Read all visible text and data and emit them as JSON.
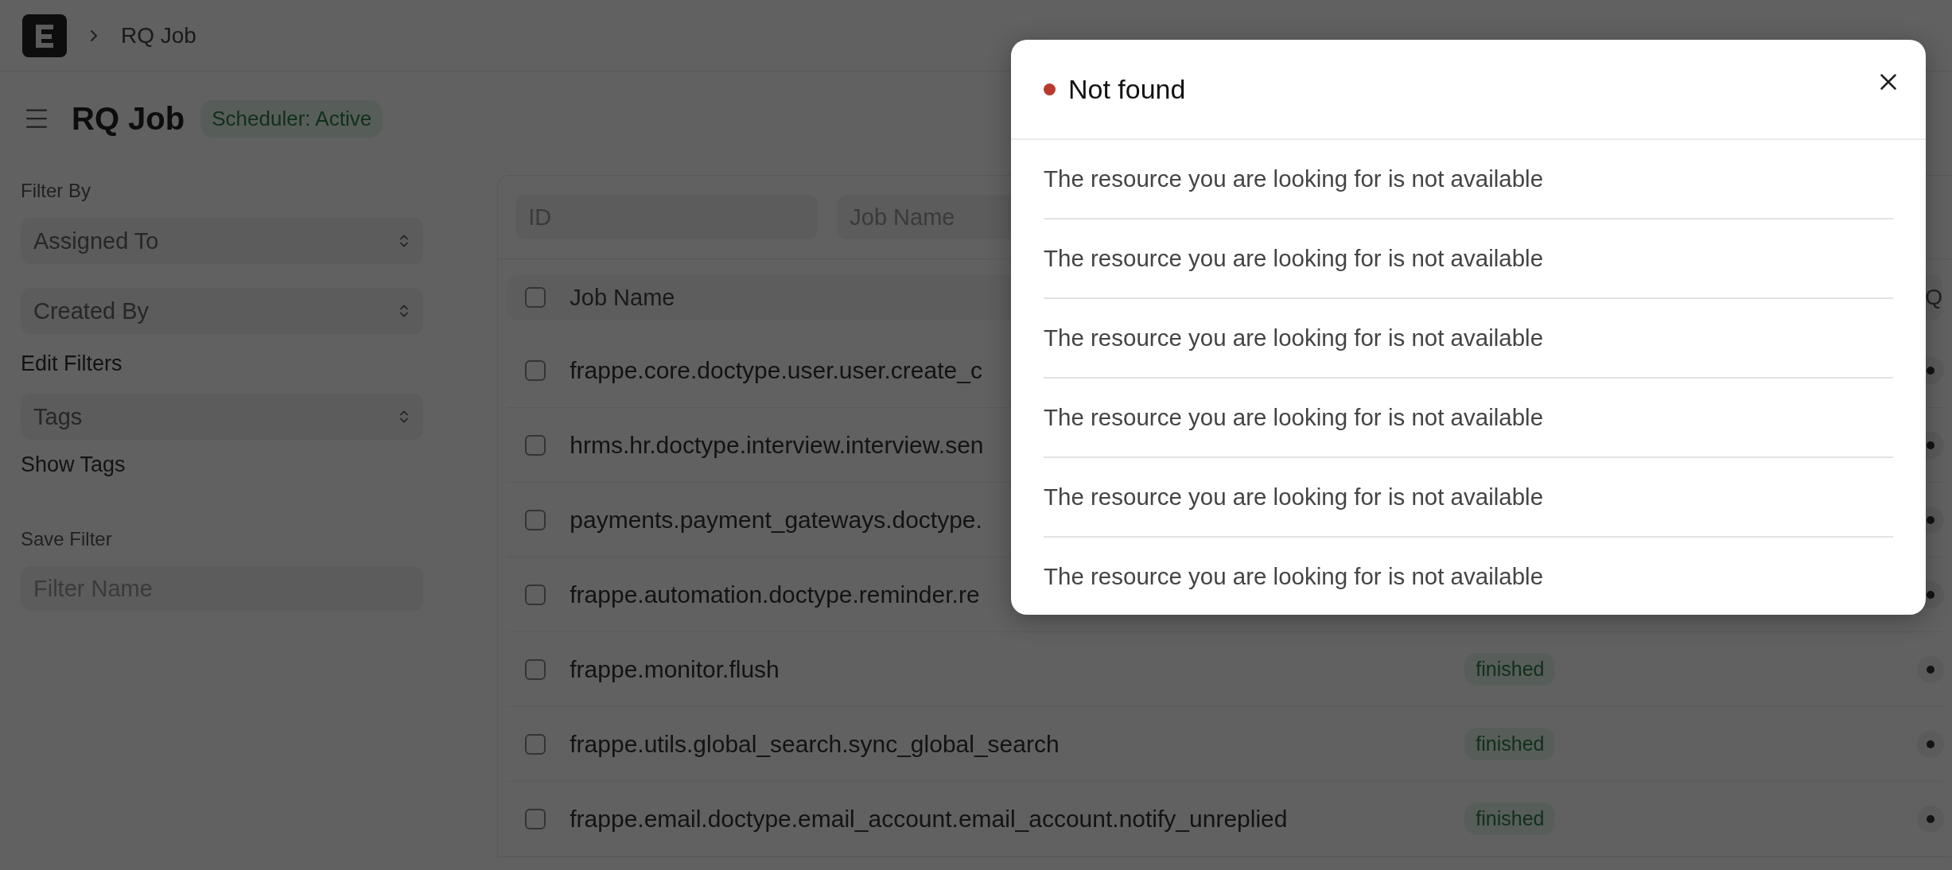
{
  "breadcrumb": {
    "items": [
      "RQ Job"
    ]
  },
  "page": {
    "title": "RQ Job",
    "status_badge": "Scheduler: Active"
  },
  "sidebar": {
    "filter_by_label": "Filter By",
    "selects": [
      {
        "placeholder": "Assigned To"
      },
      {
        "placeholder": "Created By"
      }
    ],
    "edit_filters": "Edit Filters",
    "tags_select": {
      "placeholder": "Tags"
    },
    "show_tags": "Show Tags",
    "save_filter_label": "Save Filter",
    "filter_name": {
      "placeholder": "Filter Name"
    }
  },
  "list": {
    "filters": [
      {
        "placeholder": "ID"
      },
      {
        "placeholder": "Job Name"
      }
    ],
    "header": {
      "checked": false,
      "columns": [
        "Job Name",
        "Q"
      ]
    },
    "rows": [
      {
        "job_name": "frappe.core.doctype.user.user.create_c",
        "checked": false
      },
      {
        "job_name": "hrms.hr.doctype.interview.interview.sen",
        "checked": false
      },
      {
        "job_name": "payments.payment_gateways.doctype.",
        "checked": false
      },
      {
        "job_name": "frappe.automation.doctype.reminder.re",
        "checked": false
      },
      {
        "job_name": "frappe.monitor.flush",
        "status": "finished",
        "checked": false
      },
      {
        "job_name": "frappe.utils.global_search.sync_global_search",
        "status": "finished",
        "checked": false
      },
      {
        "job_name": "frappe.email.doctype.email_account.email_account.notify_unreplied",
        "status": "finished",
        "checked": false
      }
    ]
  },
  "dialog": {
    "title": "Not found",
    "messages": [
      "The resource you are looking for is not available",
      "The resource you are looking for is not available",
      "The resource you are looking for is not available",
      "The resource you are looking for is not available",
      "The resource you are looking for is not available",
      "The resource you are looking for is not available"
    ]
  }
}
